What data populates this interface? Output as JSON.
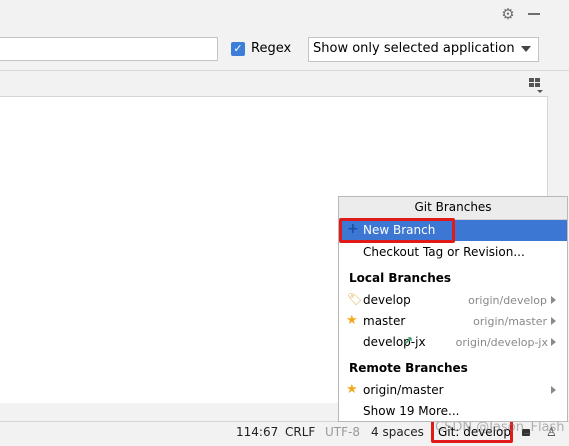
{
  "toolbar": {
    "gear_icon": "gear-icon",
    "minimize_icon": "minimize-icon"
  },
  "filter": {
    "search_value": "",
    "regex_label": "Regex",
    "regex_checked": true,
    "app_select_value": "Show only selected application"
  },
  "status_bar": {
    "position": "114:67",
    "line_separator": "CRLF",
    "encoding": "UTF-8",
    "indent": "4 spaces",
    "git_branch": "Git: develop",
    "watermark": "CSDN @Jason_Flash"
  },
  "popup": {
    "title": "Git Branches",
    "actions": [
      {
        "label": "New Branch"
      },
      {
        "label": "Checkout Tag or Revision..."
      }
    ],
    "local_header": "Local Branches",
    "local_branches": [
      {
        "name": "develop",
        "remote": "origin/develop",
        "icon": "tag-icon"
      },
      {
        "name": "master",
        "remote": "origin/master",
        "icon": "star-icon"
      },
      {
        "name": "develop-jx",
        "remote": "origin/develop-jx",
        "icon": "outgoing-arrow-icon"
      }
    ],
    "remote_header": "Remote Branches",
    "remote_branches": [
      {
        "name": "origin/master",
        "icon": "star-icon"
      }
    ],
    "show_more": "Show 19 More..."
  },
  "colors": {
    "selection": "#3c77d4",
    "highlight_border": "#e01919",
    "star": "#f2a818"
  }
}
